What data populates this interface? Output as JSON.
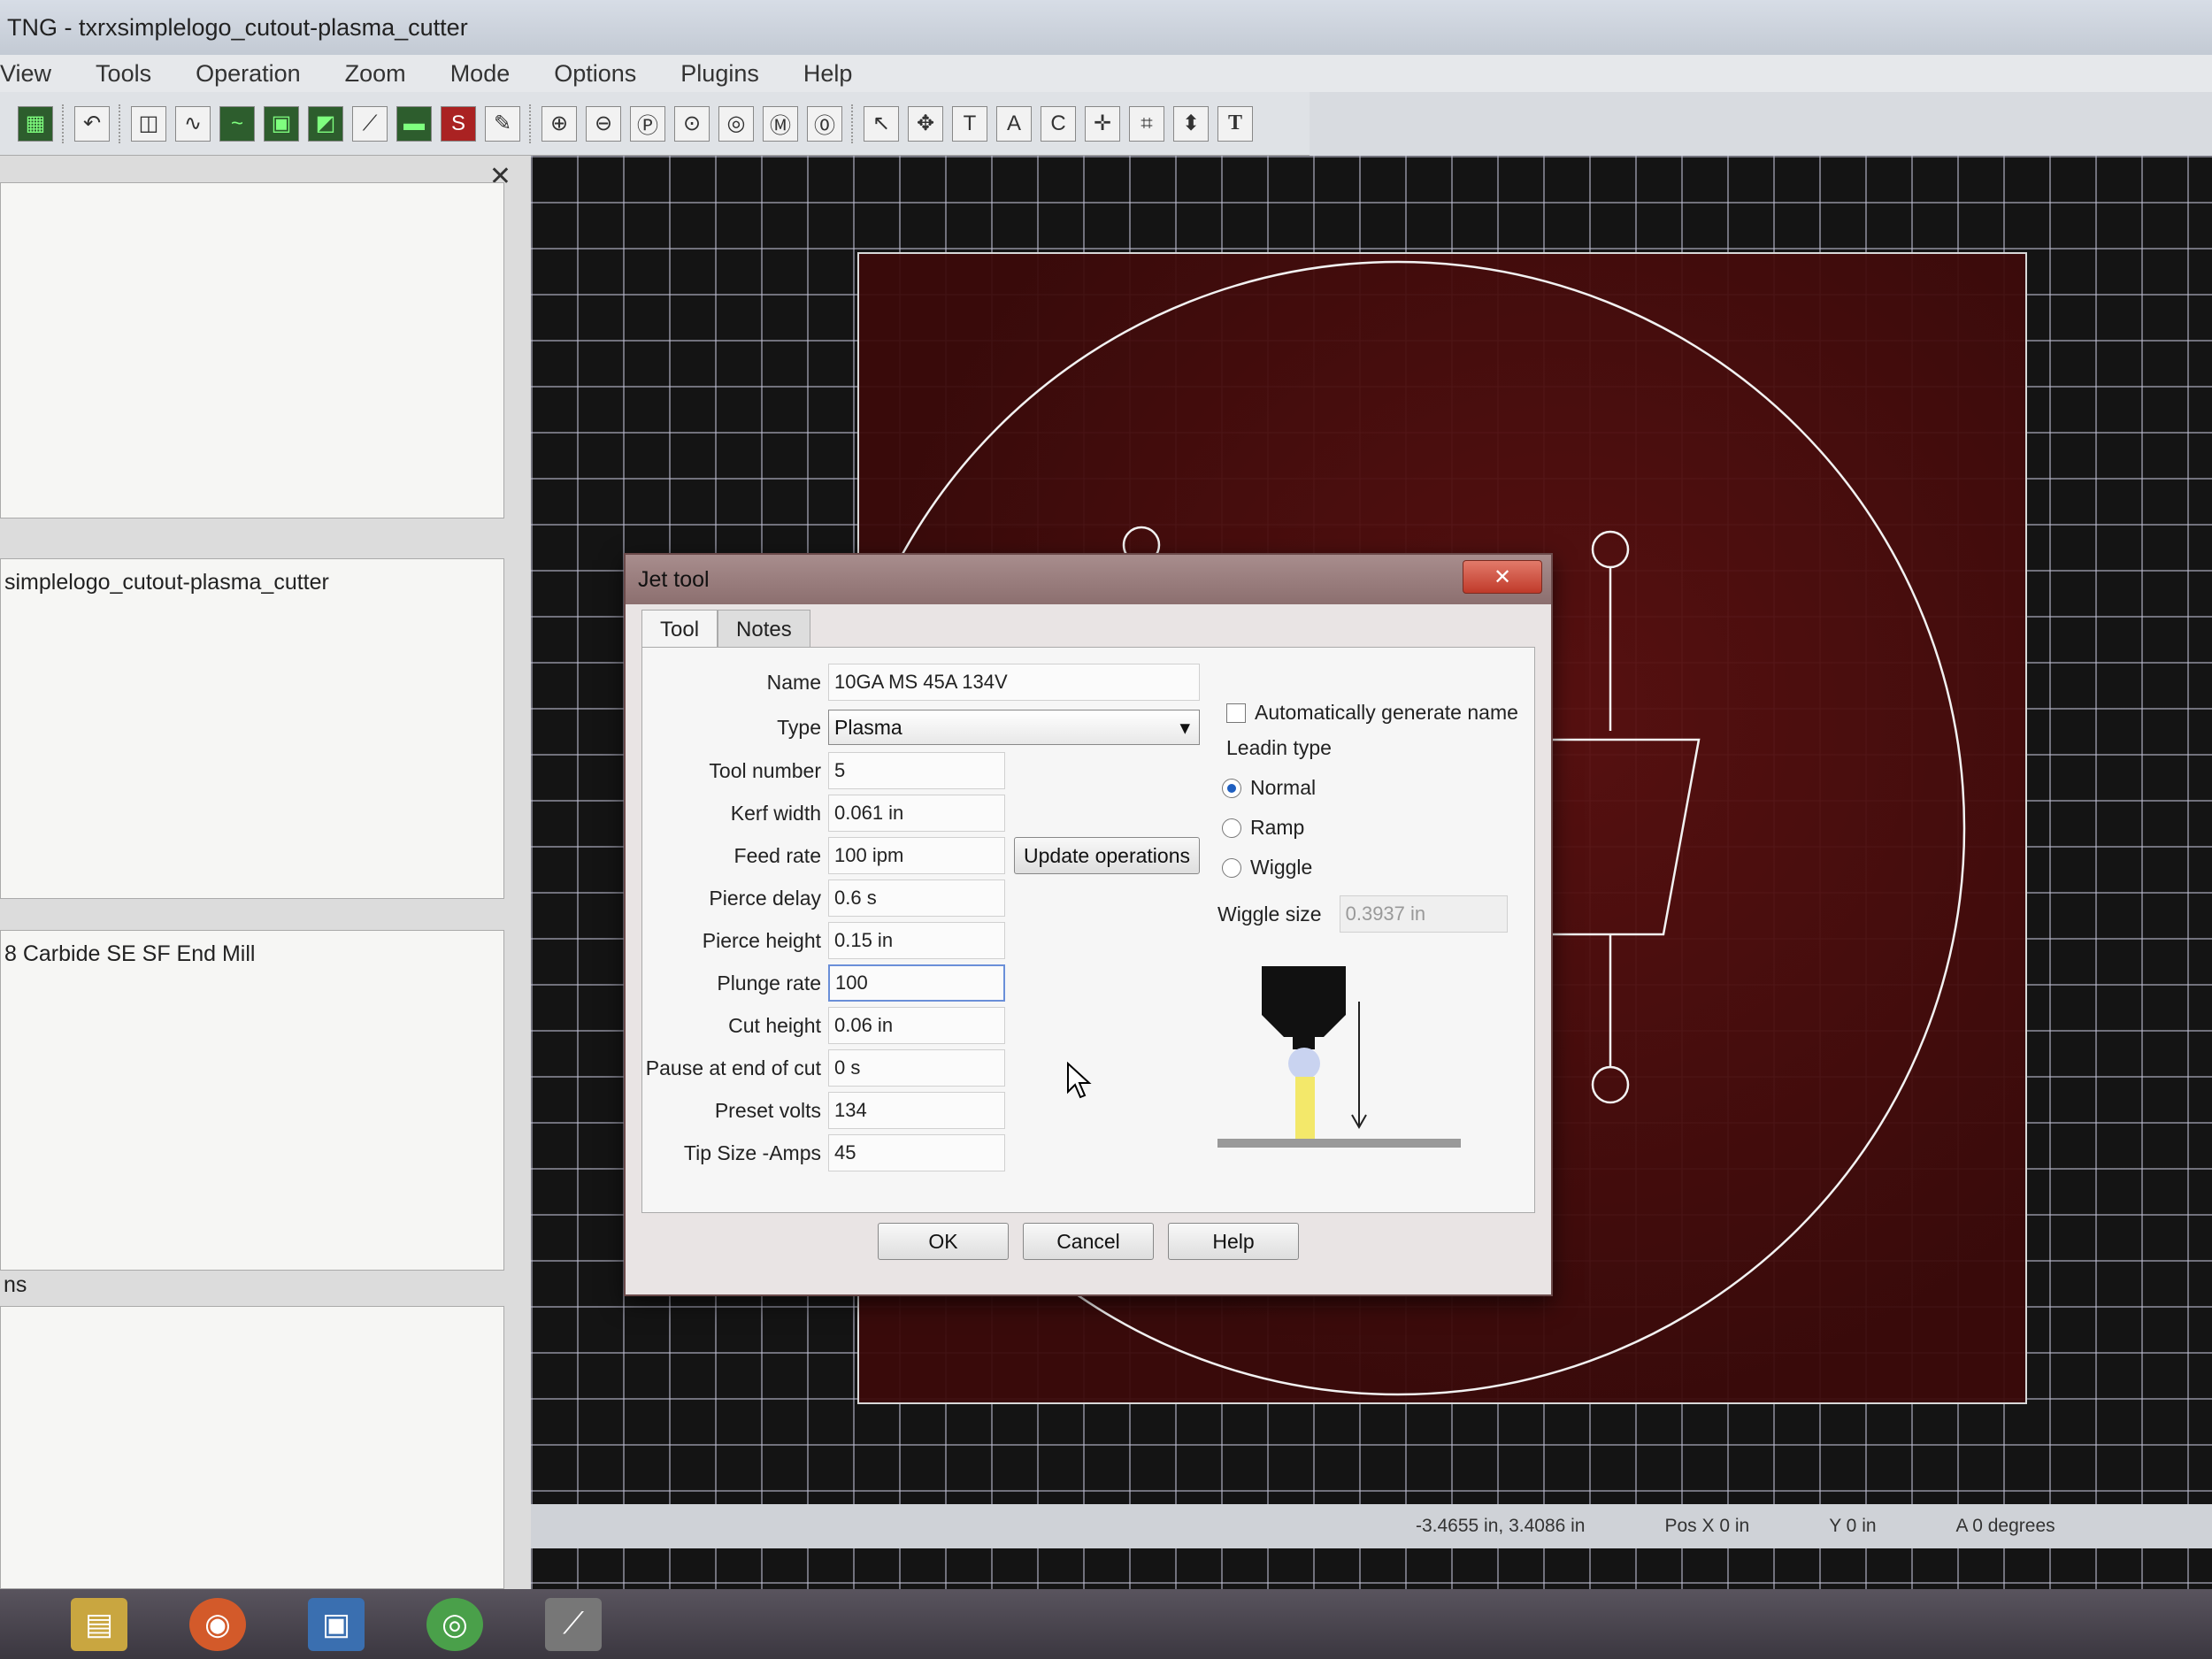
{
  "window": {
    "title": "TNG - txrxsimplelogo_cutout-plasma_cutter"
  },
  "menu": [
    "View",
    "Tools",
    "Operation",
    "Zoom",
    "Mode",
    "Options",
    "Plugins",
    "Help"
  ],
  "left_panel": {
    "project_name": "simplelogo_cutout-plasma_cutter",
    "tool_item": "8 Carbide SE SF End Mill",
    "section_label": "ns"
  },
  "dialog": {
    "title": "Jet tool",
    "close_glyph": "✕",
    "tabs": [
      "Tool",
      "Notes"
    ],
    "fields": {
      "name_label": "Name",
      "name_value": "10GA MS 45A 134V",
      "type_label": "Type",
      "type_value": "Plasma",
      "tool_number_label": "Tool number",
      "tool_number_value": "5",
      "kerf_width_label": "Kerf width",
      "kerf_width_value": "0.061 in",
      "feed_rate_label": "Feed rate",
      "feed_rate_value": "100 ipm",
      "pierce_delay_label": "Pierce delay",
      "pierce_delay_value": "0.6 s",
      "pierce_height_label": "Pierce height",
      "pierce_height_value": "0.15 in",
      "plunge_rate_label": "Plunge rate",
      "plunge_rate_value": "100",
      "cut_height_label": "Cut height",
      "cut_height_value": "0.06 in",
      "pause_label": "Pause at end of cut",
      "pause_value": "0 s",
      "preset_volts_label": "Preset volts",
      "preset_volts_value": "134",
      "tip_size_label": "Tip Size -Amps",
      "tip_size_value": "45"
    },
    "update_operations": "Update operations",
    "auto_name_label": "Automatically generate name",
    "leadin_label": "Leadin type",
    "leadin_options": [
      {
        "label": "Normal",
        "selected": true
      },
      {
        "label": "Ramp",
        "selected": false
      },
      {
        "label": "Wiggle",
        "selected": false
      }
    ],
    "wiggle_size_label": "Wiggle size",
    "wiggle_size_value": "0.3937 in",
    "buttons": {
      "ok": "OK",
      "cancel": "Cancel",
      "help": "Help"
    }
  },
  "status": {
    "cursor_pos": "-3.4655 in, 3.4086 in",
    "pos_x": "Pos X  0 in",
    "pos_y": "Y  0 in",
    "angle": "A  0 degrees"
  },
  "colors": {
    "canvas_bg": "#141414",
    "stock_red": "#5a1010",
    "accent": "#1f5fc0"
  }
}
